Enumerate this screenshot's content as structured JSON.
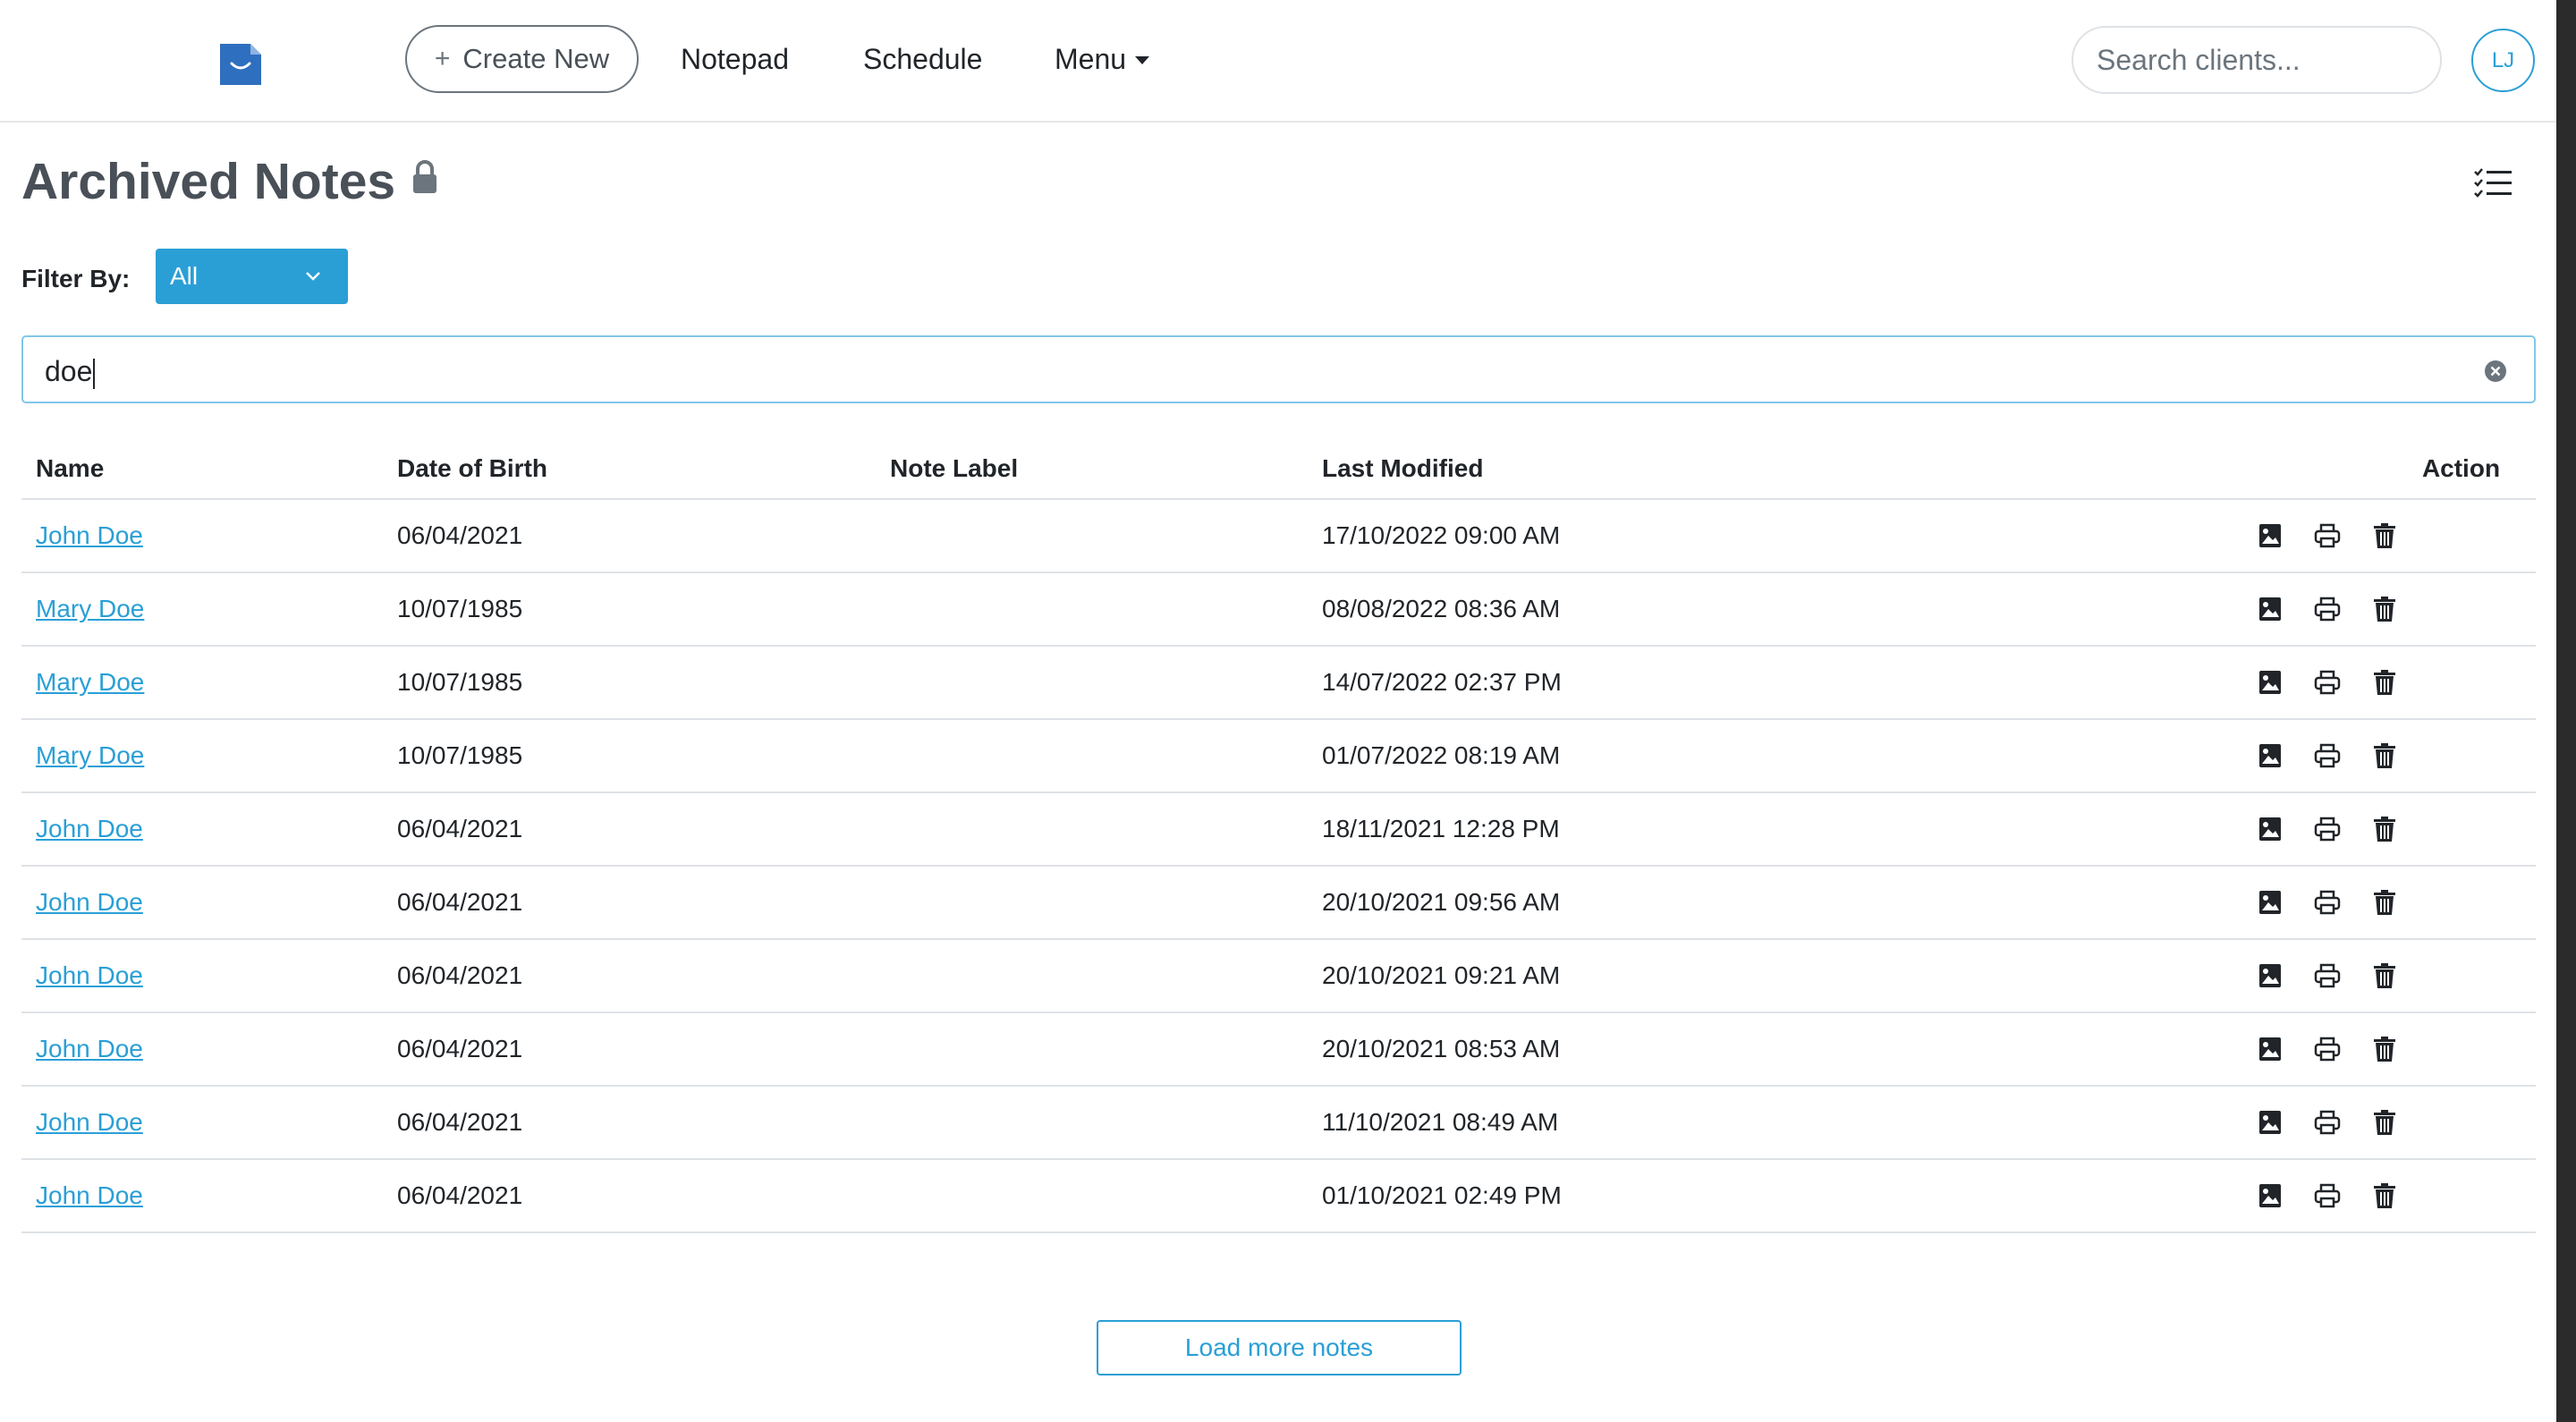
{
  "nav": {
    "create_label": "Create New",
    "notepad": "Notepad",
    "schedule": "Schedule",
    "menu": "Menu",
    "search_placeholder": "Search clients...",
    "avatar_initials": "LJ"
  },
  "page": {
    "title": "Archived Notes",
    "filter_label": "Filter By:",
    "filter_value": "All",
    "search_value": "doe",
    "load_more": "Load more notes"
  },
  "table": {
    "headers": {
      "name": "Name",
      "dob": "Date of Birth",
      "label": "Note Label",
      "modified": "Last Modified",
      "action": "Action"
    },
    "rows": [
      {
        "name": "John Doe",
        "dob": "06/04/2021",
        "label": "",
        "modified": "17/10/2022 09:00 AM"
      },
      {
        "name": "Mary Doe",
        "dob": "10/07/1985",
        "label": "",
        "modified": "08/08/2022 08:36 AM"
      },
      {
        "name": "Mary Doe",
        "dob": "10/07/1985",
        "label": "",
        "modified": "14/07/2022 02:37 PM"
      },
      {
        "name": "Mary Doe",
        "dob": "10/07/1985",
        "label": "",
        "modified": "01/07/2022 08:19 AM"
      },
      {
        "name": "John Doe",
        "dob": "06/04/2021",
        "label": "",
        "modified": "18/11/2021 12:28 PM"
      },
      {
        "name": "John Doe",
        "dob": "06/04/2021",
        "label": "",
        "modified": "20/10/2021 09:56 AM"
      },
      {
        "name": "John Doe",
        "dob": "06/04/2021",
        "label": "",
        "modified": "20/10/2021 09:21 AM"
      },
      {
        "name": "John Doe",
        "dob": "06/04/2021",
        "label": "",
        "modified": "20/10/2021 08:53 AM"
      },
      {
        "name": "John Doe",
        "dob": "06/04/2021",
        "label": "",
        "modified": "11/10/2021 08:49 AM"
      },
      {
        "name": "John Doe",
        "dob": "06/04/2021",
        "label": "",
        "modified": "01/10/2021 02:49 PM"
      }
    ]
  },
  "icons": {
    "logo": "app-logo-icon",
    "lock": "lock-icon",
    "list_view": "checklist-icon",
    "chevron": "chevron-down-icon",
    "clear": "clear-circle-icon",
    "row_actions": [
      "image-icon",
      "printer-icon",
      "trash-icon"
    ]
  },
  "colors": {
    "accent": "#2a9fd6",
    "title": "#495057",
    "border": "#dee2e6"
  }
}
